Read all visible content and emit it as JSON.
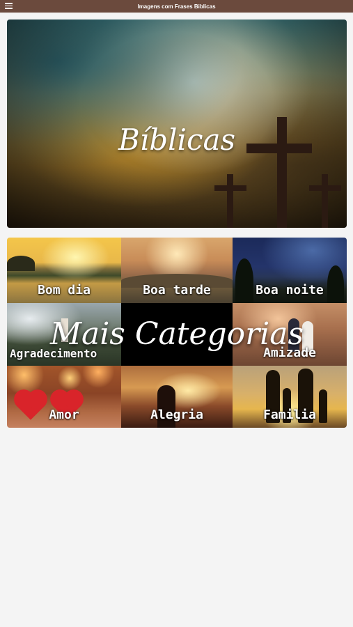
{
  "app": {
    "title": "Imagens com Frases Biblicas"
  },
  "hero": {
    "title": "Bíblicas"
  },
  "categories": {
    "overlay_title": "Mais Categorias",
    "items": [
      {
        "label": "Bom dia"
      },
      {
        "label": "Boa tarde"
      },
      {
        "label": "Boa noite"
      },
      {
        "label": "Agradecimento"
      },
      {
        "label": ""
      },
      {
        "label": "Amizade"
      },
      {
        "label": "Amor"
      },
      {
        "label": "Alegria"
      },
      {
        "label": "Familia"
      }
    ]
  },
  "colors": {
    "topbar": "#6b4a3d",
    "background": "#f4f4f4",
    "text_on_image": "#ffffff"
  },
  "icons": {
    "menu": "hamburger-menu-icon"
  }
}
